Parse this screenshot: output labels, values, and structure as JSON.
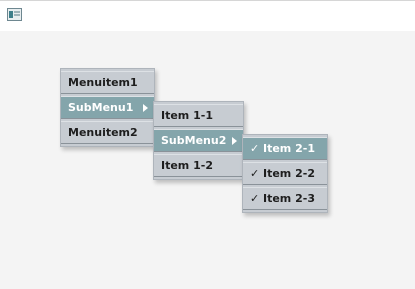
{
  "menu1": {
    "items": [
      {
        "label": "Menuitem1"
      },
      {
        "label": "SubMenu1"
      },
      {
        "label": "Menuitem2"
      }
    ]
  },
  "menu2": {
    "items": [
      {
        "label": "Item 1-1"
      },
      {
        "label": "SubMenu2"
      },
      {
        "label": "Item 1-2"
      }
    ]
  },
  "menu3": {
    "check": "✓",
    "items": [
      {
        "label": "Item 2-1"
      },
      {
        "label": "Item 2-2"
      },
      {
        "label": "Item 2-3"
      }
    ]
  },
  "colors": {
    "menu_bg": "#c7ccd2",
    "selected_bg": "#84a5ab",
    "page_bg": "#f4f4f4"
  },
  "icons": {
    "app": "window-icon",
    "submenu": "submenu-arrow-icon",
    "check": "check-icon"
  }
}
